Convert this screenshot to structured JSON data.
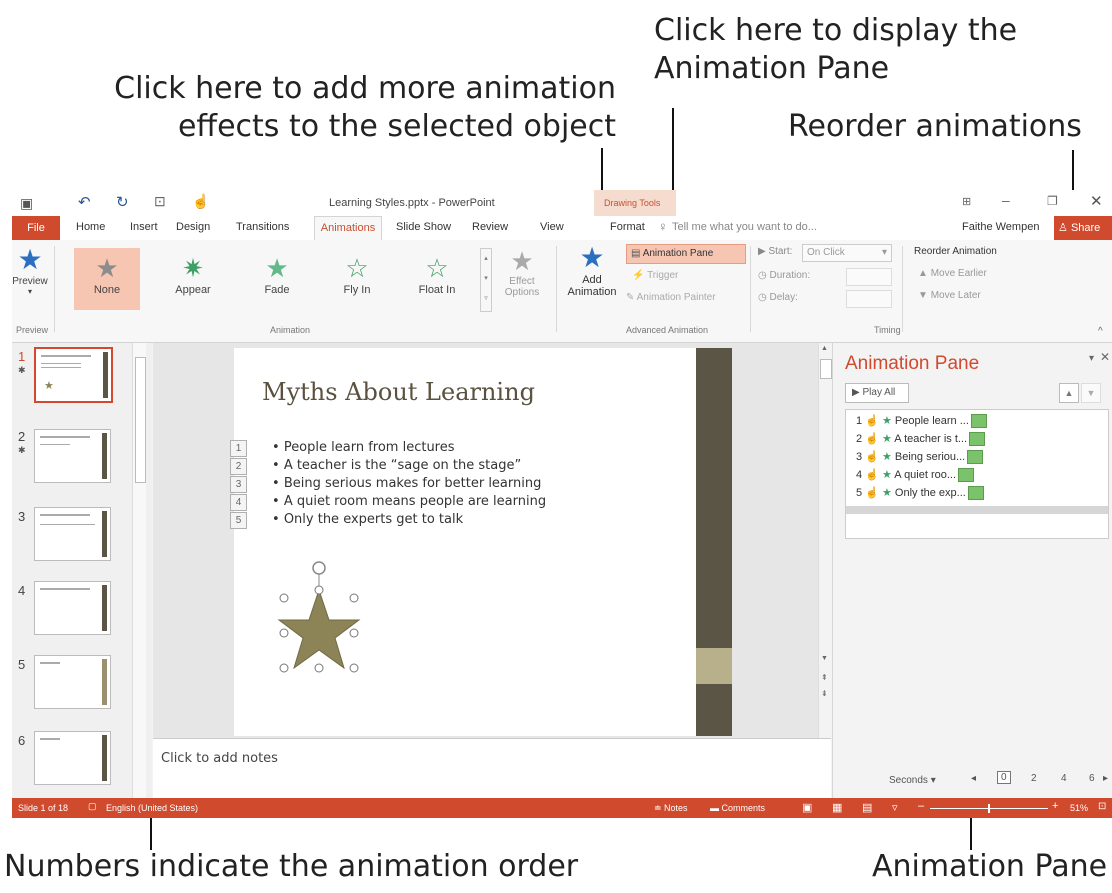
{
  "callouts": {
    "add_animation": [
      "Click here to add more animation",
      "effects to the selected object"
    ],
    "animation_pane_btn": [
      "Click here to display the",
      "Animation Pane"
    ],
    "reorder": "Reorder animations",
    "numbers": "Numbers indicate the animation order",
    "pane": "Animation Pane"
  },
  "titlebar": {
    "title": "Learning Styles.pptx - PowerPoint",
    "context": "Drawing Tools"
  },
  "tabs": [
    "File",
    "Home",
    "Insert",
    "Design",
    "Transitions",
    "Animations",
    "Slide Show",
    "Review",
    "View",
    "Format"
  ],
  "tell_me": "Tell me what you want to do...",
  "user": "Faithe Wempen",
  "share": "Share",
  "ribbon": {
    "preview": "Preview",
    "preview_group": "Preview",
    "gallery": [
      "None",
      "Appear",
      "Fade",
      "Fly In",
      "Float In"
    ],
    "animation_group": "Animation",
    "effect_options": [
      "Effect",
      "Options"
    ],
    "add_animation": [
      "Add",
      "Animation"
    ],
    "animation_pane": "Animation Pane",
    "trigger": "Trigger",
    "animation_painter": "Animation Painter",
    "advanced_group": "Advanced Animation",
    "start_label": "Start:",
    "start_value": "On Click",
    "duration_label": "Duration:",
    "delay_label": "Delay:",
    "timing_group": "Timing",
    "reorder_title": "Reorder Animation",
    "move_earlier": "Move Earlier",
    "move_later": "Move Later"
  },
  "thumbs": [
    "1",
    "2",
    "3",
    "4",
    "5",
    "6"
  ],
  "slide": {
    "title": "Myths About Learning",
    "bullets": [
      "People learn from lectures",
      "A teacher is the “sage on the stage”",
      "Being serious makes for better learning",
      "A quiet room means people are learning",
      "Only the experts get to talk"
    ],
    "numbers": [
      "1",
      "2",
      "3",
      "4",
      "5"
    ]
  },
  "notes_placeholder": "Click to add notes",
  "pane": {
    "title": "Animation Pane",
    "play_all": "Play All",
    "items": [
      {
        "num": "1",
        "label": "People learn ..."
      },
      {
        "num": "2",
        "label": "A teacher is t..."
      },
      {
        "num": "3",
        "label": "Being seriou..."
      },
      {
        "num": "4",
        "label": "A quiet roo..."
      },
      {
        "num": "5",
        "label": "Only the exp..."
      }
    ],
    "seconds": "Seconds",
    "timeline": [
      "0",
      "2",
      "4",
      "6"
    ]
  },
  "status": {
    "slide": "Slide 1 of 18",
    "language": "English (United States)",
    "notes": "Notes",
    "comments": "Comments",
    "zoom": "51%"
  },
  "colors": {
    "accent": "#d04a2e",
    "slide_bar": "#5b5545",
    "star": "#8c8456"
  }
}
